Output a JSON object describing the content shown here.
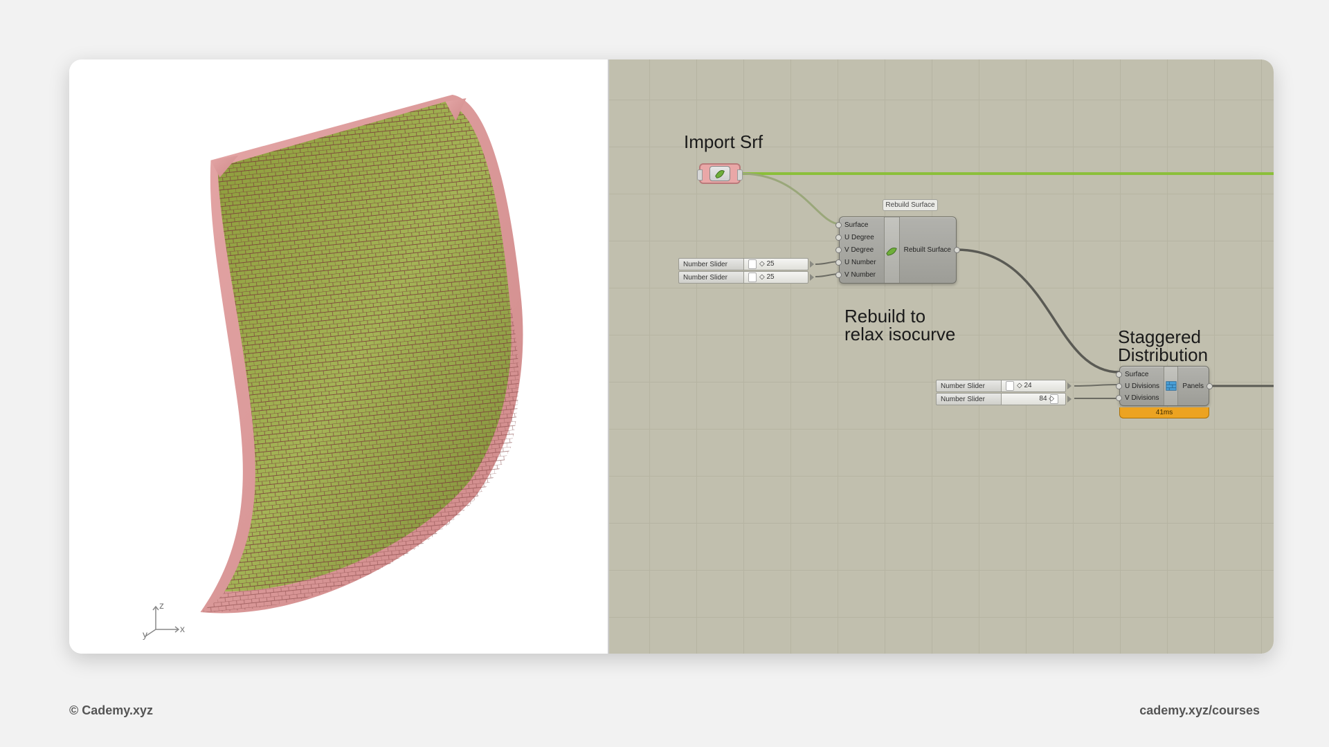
{
  "footer": {
    "left": "© Cademy.xyz",
    "right": "cademy.xyz/courses"
  },
  "axes": {
    "z": "z",
    "y": "y",
    "x": "x"
  },
  "canvas": {
    "import_label": "Import Srf",
    "rebuild_label": "Rebuild to\nrelax isocurve",
    "rebuild_tag": "Rebuild Surface",
    "stagger_label": "Staggered\nDistribution",
    "sliders": {
      "s1": {
        "label": "Number Slider",
        "value": "25"
      },
      "s2": {
        "label": "Number Slider",
        "value": "25"
      },
      "s3": {
        "label": "Number Slider",
        "value": "24"
      },
      "s4": {
        "label": "Number Slider",
        "value": "84"
      }
    },
    "rebuild_ports_in": [
      "Surface",
      "U Degree",
      "V Degree",
      "U Number",
      "V Number"
    ],
    "rebuild_ports_out": [
      "Rebuilt Surface"
    ],
    "stagger_ports_in": [
      "Surface",
      "U Divisions",
      "V Divisions"
    ],
    "stagger_ports_out": [
      "Panels"
    ],
    "stagger_time": "41ms"
  }
}
